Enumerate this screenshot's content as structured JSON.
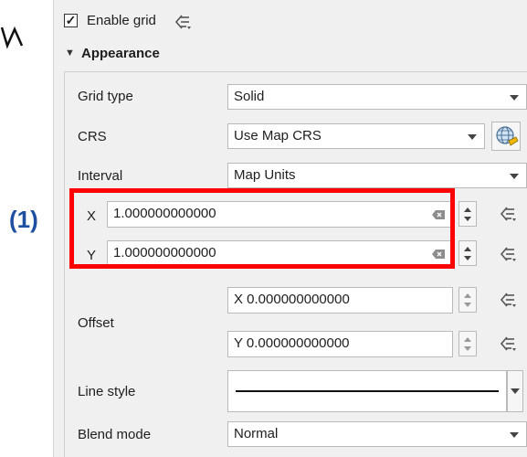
{
  "enable_grid": {
    "label": "Enable grid",
    "checked": true,
    "checkmark": "✓"
  },
  "appearance": {
    "title": "Appearance",
    "arrow": "▼"
  },
  "grid_type": {
    "label": "Grid type",
    "value": "Solid"
  },
  "crs": {
    "label": "CRS",
    "value": "Use Map CRS"
  },
  "interval": {
    "label": "Interval",
    "unit": "Map Units",
    "x_prefix": "X",
    "x_value": "1.000000000000",
    "y_prefix": "Y",
    "y_value": "1.000000000000"
  },
  "offset": {
    "label": "Offset",
    "x_value": "X 0.000000000000",
    "y_value": "Y 0.000000000000"
  },
  "line_style": {
    "label": "Line style"
  },
  "blend_mode": {
    "label": "Blend mode",
    "value": "Normal"
  },
  "annotation": {
    "label": "(1)",
    "color": "#ff0000"
  },
  "icons": {
    "data_defined": "data-defined-override-icon",
    "globe": "globe-crs-icon",
    "clear": "clear-field-icon"
  }
}
